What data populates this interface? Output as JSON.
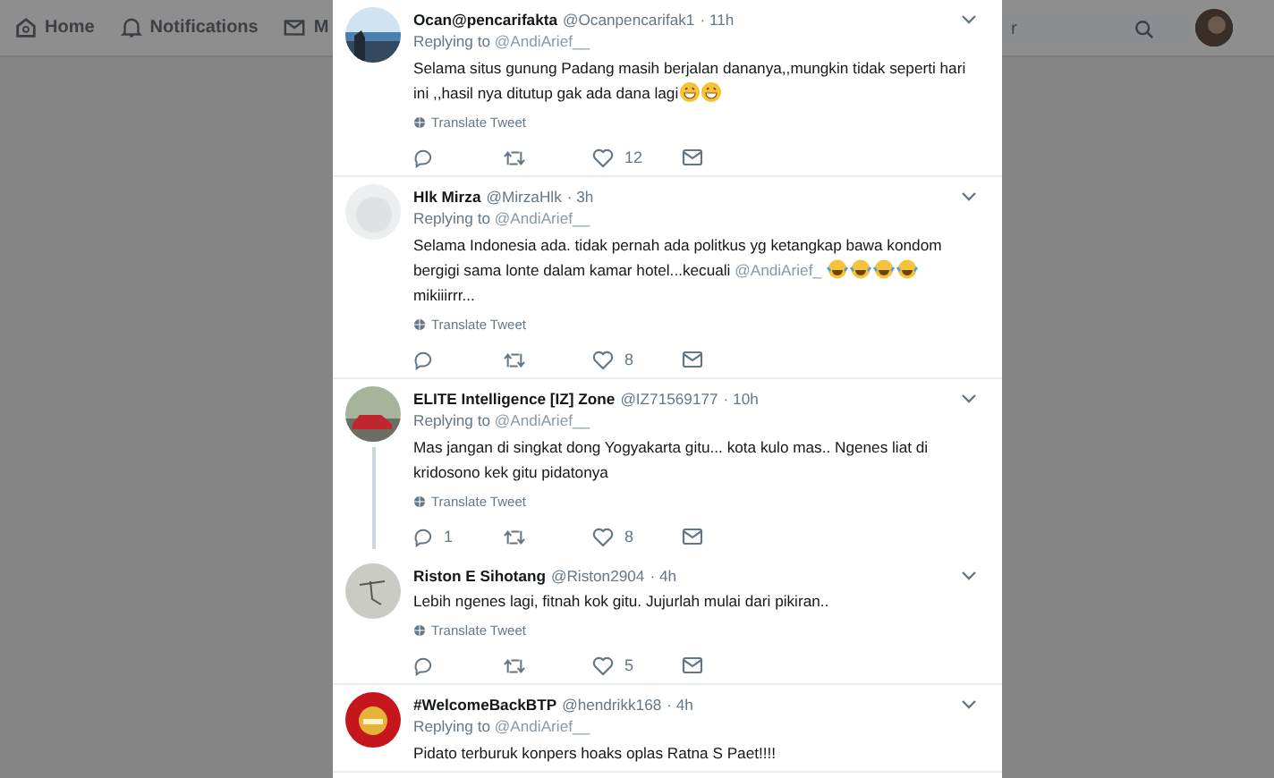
{
  "nav": {
    "items": [
      {
        "kind": "home",
        "label": "Home"
      },
      {
        "kind": "bell",
        "label": "Notifications"
      },
      {
        "kind": "mail",
        "label": "M"
      }
    ],
    "search": {
      "placeholder": "r"
    }
  },
  "tweets": [
    {
      "name": "Ocan@pencarifakta",
      "handle": "@Ocanpencarifak1",
      "time": "· 11h",
      "replying_label": "Replying to",
      "replying_to": "@AndiArief__",
      "body": [
        {
          "kind": "text",
          "text": "Selama situs gunung Padang masih berjalan dananya,,mungkin tidak seperti hari ini ,,hasil nya ditutup gak ada dana lagi"
        },
        {
          "kind": "grin"
        },
        {
          "kind": "grin"
        }
      ],
      "translate": "Translate Tweet",
      "likes": "12",
      "thread_below": false
    },
    {
      "name": "Hlk Mirza",
      "handle": "@MirzaHlk",
      "time": "· 3h",
      "replying_label": "Replying to",
      "replying_to": "@AndiArief__",
      "body": [
        {
          "kind": "text",
          "text": "Selama Indonesia ada. tidak pernah ada politkus yg ketangkap bawa kondom bergigi sama lonte dalam kamar hotel...kecuali"
        },
        {
          "kind": "mention",
          "text": "@AndiArief_"
        },
        {
          "kind": "tears"
        },
        {
          "kind": "tears"
        },
        {
          "kind": "tears"
        },
        {
          "kind": "tears"
        },
        {
          "kind": "text",
          "text": "mikiiirrr..."
        }
      ],
      "translate": "Translate Tweet",
      "likes": "8",
      "thread_below": false
    },
    {
      "name": "ELITE Intelligence [IZ] Zone",
      "handle": "@IZ71569177",
      "time": "· 10h",
      "replying_label": "Replying to",
      "replying_to": "@AndiArief__",
      "body": [
        {
          "kind": "text",
          "text": "Mas jangan di singkat dong Yogyakarta gitu...  kota kulo mas..  Ngenes liat di kridosono kek gitu pidatonya"
        }
      ],
      "translate": "Translate Tweet",
      "replies": "1",
      "likes": "8",
      "thread_below": true
    },
    {
      "name": "Riston E Sihotang",
      "handle": "@Riston2904",
      "time": "· 4h",
      "body": [
        {
          "kind": "text",
          "text": "Lebih ngenes lagi, fitnah kok gitu. Jujurlah mulai dari pikiran.."
        }
      ],
      "translate": "Translate Tweet",
      "likes": "5",
      "thread_below": false
    },
    {
      "name": "#WelcomeBackBTP",
      "handle": "@hendrikk168",
      "time": "· 4h",
      "replying_label": "Replying to",
      "replying_to": "@AndiArief__",
      "body": [
        {
          "kind": "text",
          "text": "Pidato terburuk konpers hoaks oplas Ratna S Paet!!!!"
        }
      ],
      "thread_below": false
    }
  ]
}
